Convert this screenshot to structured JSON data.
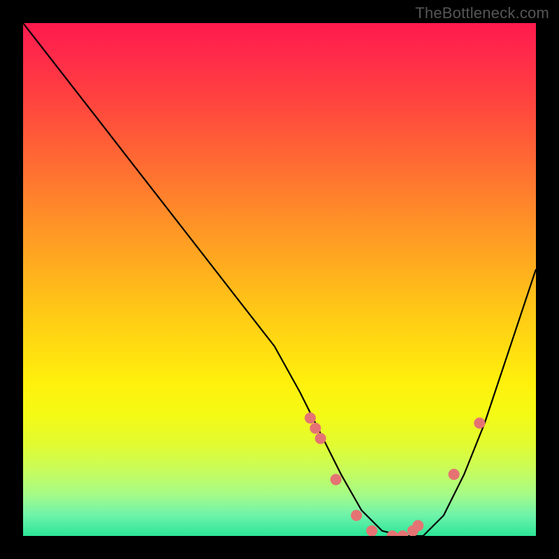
{
  "watermark": "TheBottleneck.com",
  "chart_data": {
    "type": "line",
    "title": "",
    "xlabel": "",
    "ylabel": "",
    "xlim": [
      0,
      100
    ],
    "ylim": [
      0,
      100
    ],
    "series": [
      {
        "name": "bottleneck-curve",
        "x": [
          0,
          7,
          14,
          21,
          28,
          35,
          42,
          49,
          54,
          58,
          62,
          66,
          70,
          74,
          78,
          82,
          86,
          90,
          94,
          100
        ],
        "y": [
          100,
          91,
          82,
          73,
          64,
          55,
          46,
          37,
          28,
          20,
          12,
          5,
          1,
          0,
          0,
          4,
          12,
          22,
          34,
          52
        ]
      }
    ],
    "highlight_points": {
      "name": "marked-dots",
      "x": [
        56,
        57,
        58,
        61,
        65,
        68,
        72,
        74,
        76,
        77,
        84,
        89
      ],
      "y": [
        23,
        21,
        19,
        11,
        4,
        1,
        0,
        0,
        1,
        2,
        12,
        22
      ]
    },
    "background_gradient": {
      "top": "#ff1a4d",
      "mid": "#ffe600",
      "bottom": "#2be597"
    }
  }
}
